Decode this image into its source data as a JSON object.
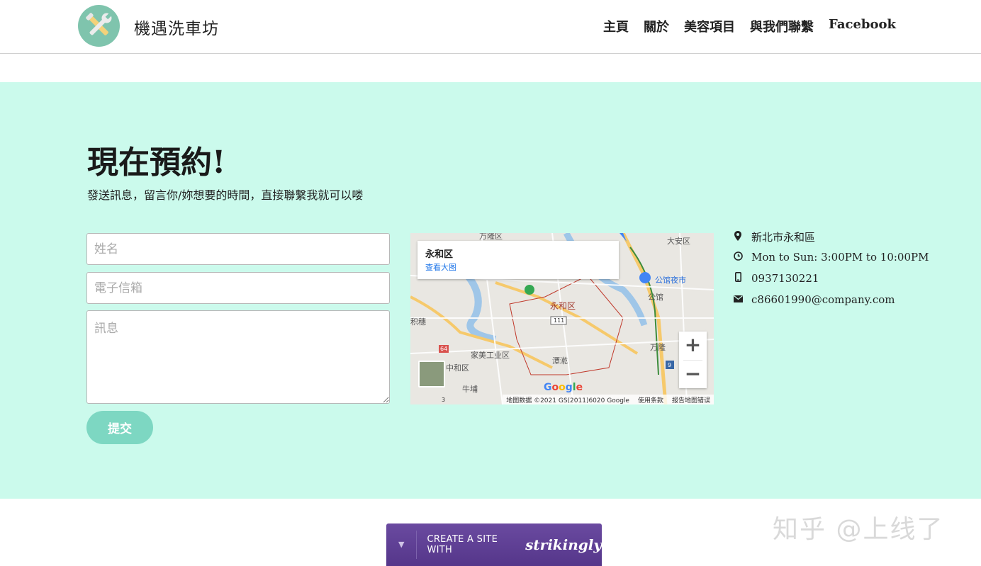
{
  "header": {
    "brand_name": "機遇洗車坊",
    "logo_icon": "wrench-screwdriver-icon",
    "nav": [
      {
        "label": "主頁"
      },
      {
        "label": "關於"
      },
      {
        "label": "美容項目"
      },
      {
        "label": "與我們聯繫"
      },
      {
        "label": "Facebook"
      }
    ]
  },
  "contact_section": {
    "title": "現在預約!",
    "subtitle": "發送訊息，留言你/妳想要的時間，直接聯繫我就可以喽",
    "form": {
      "name_placeholder": "姓名",
      "email_placeholder": "電子信箱",
      "message_placeholder": "訊息",
      "submit_label": "提交"
    },
    "map": {
      "place_name": "永和区",
      "view_larger": "查看大图",
      "zoom_in": "+",
      "zoom_out": "−",
      "google": "Google",
      "attribution": "地图数据 ©2021 GS(2011)6020 Google",
      "terms": "使用条款",
      "report": "报告地图错误",
      "labels": [
        "万隆区",
        "大安区",
        "公馆夜市",
        "公馆",
        "永和区",
        "中和区",
        "家美工业区",
        "牛埔",
        "潭漧",
        "万隆",
        "积穗"
      ],
      "road_numbers": [
        "111",
        "64",
        "9",
        "3"
      ]
    },
    "info": {
      "address": "新北市永和區",
      "hours": "Mon to Sun: 3:00PM to 10:00PM",
      "phone": "0937130221",
      "email": "c86601990@company.com",
      "icons": [
        "map-pin-icon",
        "clock-icon",
        "phone-icon",
        "envelope-icon"
      ]
    }
  },
  "footer": {
    "create_text": "CREATE A SITE WITH",
    "brand": "strikingly",
    "watermark": "知乎 @上线了"
  },
  "colors": {
    "section_bg": "#cbfaec",
    "button_bg": "#7dd7c2",
    "logo_bg": "#7fc4ad",
    "footer_btn": "#6a4aa0"
  }
}
